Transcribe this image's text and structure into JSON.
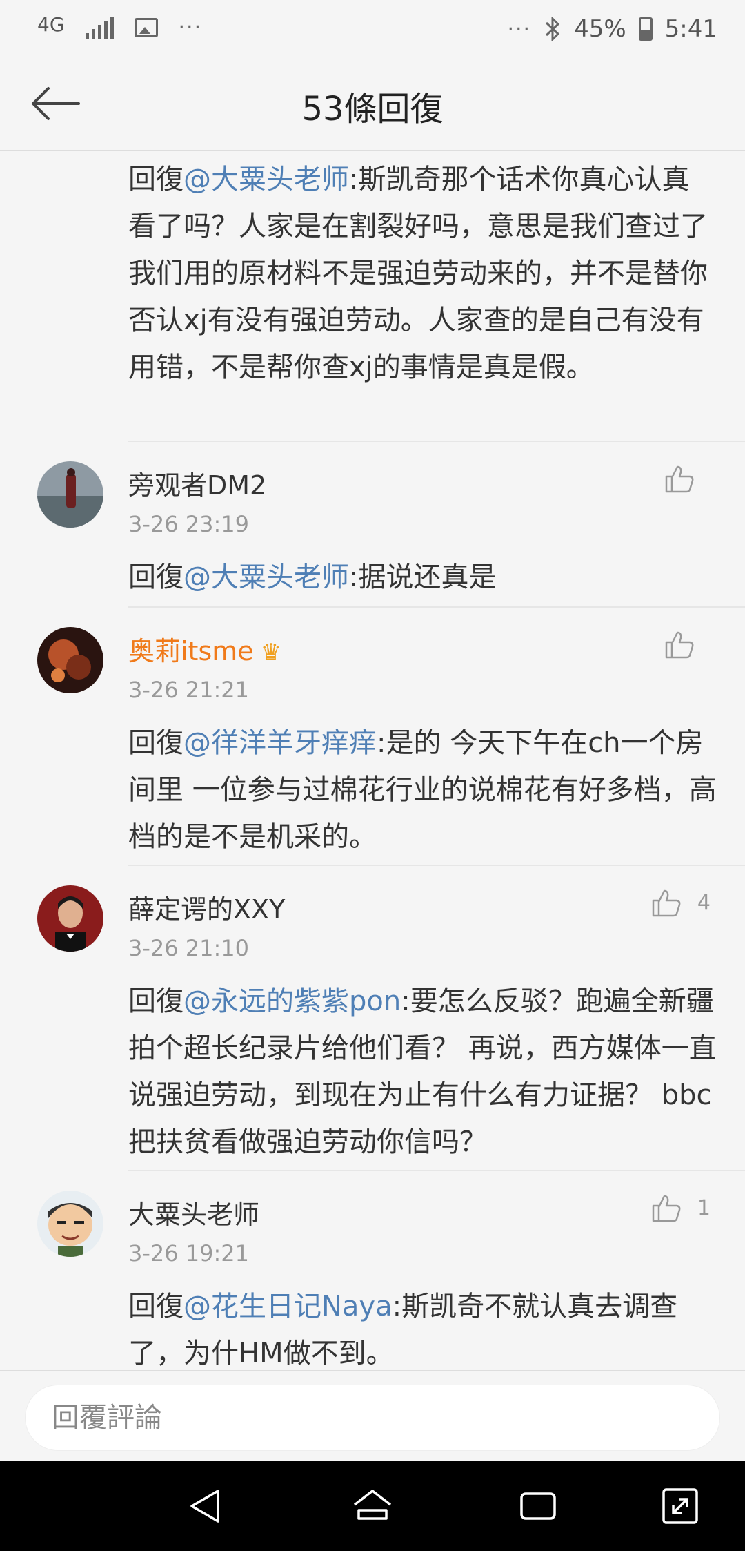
{
  "status_bar": {
    "network": "4G",
    "battery_percent": "45%",
    "time": "5:41",
    "overflow": "···"
  },
  "header": {
    "title": "53條回復"
  },
  "first_comment_tail": {
    "prefix": "回復",
    "mention": "@大粟头老师",
    "text": ":斯凯奇那个话术你真心认真看了吗？人家是在割裂好吗，意思是我们查过了我们用的原材料不是强迫劳动来的，并不是替你否认xj有没有强迫劳动。人家查的是自己有没有用错，不是帮你查xj的事情是真是假。"
  },
  "comments": [
    {
      "username": "旁观者DM2",
      "timestamp": "3-26 23:19",
      "likes": "",
      "prefix": "回復",
      "mention": "@大粟头老师",
      "text": ":据说还真是"
    },
    {
      "username": "奥莉itsme",
      "timestamp": "3-26 21:21",
      "likes": "",
      "prefix": "回復",
      "mention": "@徉洋羊牙痒痒",
      "text": ":是的 今天下午在ch一个房间里 一位参与过棉花行业的说棉花有好多档，高档的是不是机采的。"
    },
    {
      "username": "薛定谔的XXY",
      "timestamp": "3-26 21:10",
      "likes": "4",
      "prefix": "回復",
      "mention": "@永远的紫紫pon",
      "text": ":要怎么反驳？跑遍全新疆拍个超长纪录片给他们看？ 再说，西方媒体一直说强迫劳动，到现在为止有什么有力证据？ bbc把扶贫看做强迫劳动你信吗？"
    },
    {
      "username": "大粟头老师",
      "timestamp": "3-26 19:21",
      "likes": "1",
      "prefix": "回復",
      "mention": "@花生日记Naya",
      "text": ":斯凯奇不就认真去调查了，为什HM做不到。"
    }
  ],
  "reply_input": {
    "placeholder": "回覆評論"
  },
  "colors": {
    "mention": "#4f7fb5",
    "vip_name": "#f07a1a",
    "background": "#f5f5f5"
  }
}
